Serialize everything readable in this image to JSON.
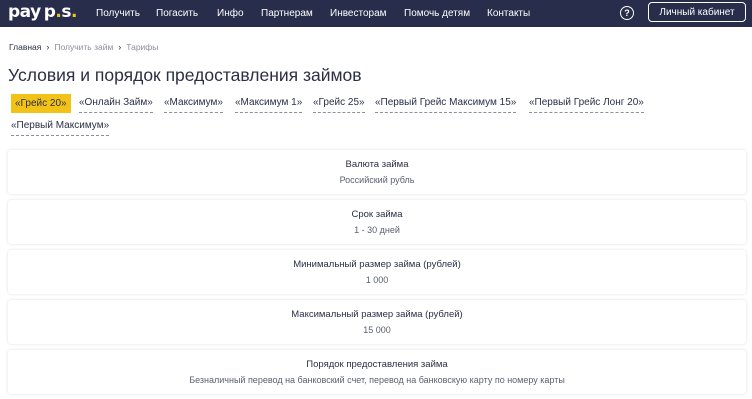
{
  "header": {
    "logo_pay": "pay",
    "logo_ps": "p.s.",
    "nav": [
      "Получить",
      "Погасить",
      "Инфо",
      "Партнерам",
      "Инвесторам",
      "Помочь детям",
      "Контакты"
    ],
    "help_icon": "?",
    "cabinet_label": "Личный кабинет"
  },
  "breadcrumb": {
    "home": "Главная",
    "parent": "Получить займ",
    "current": "Тарифы"
  },
  "page_title": "Условия и порядок предоставления займов",
  "tariffs": [
    "«Грейс 20»",
    "«Онлайн Займ»",
    "«Максимум»",
    "«Максимум 1»",
    "«Грейс 25»",
    "«Первый Грейс Максимум 15»",
    "«Первый Грейс Лонг 20»",
    "«Первый Максимум»"
  ],
  "active_tariff": "«Грейс 20»",
  "conditions": [
    {
      "label": "Валюта займа",
      "value": "Российский рубль"
    },
    {
      "label": "Срок займа",
      "value": "1 - 30 дней"
    },
    {
      "label": "Минимальный размер займа (рублей)",
      "value": "1 000"
    },
    {
      "label": "Максимальный размер займа (рублей)",
      "value": "15 000"
    },
    {
      "label": "Порядок предоставления займа",
      "value": "Безналичный перевод на банковский счет, перевод на банковскую карту по номеру карты"
    }
  ],
  "colors": {
    "header_bg": "#272d4a",
    "accent": "#f2c316",
    "text": "#2a2f45"
  }
}
